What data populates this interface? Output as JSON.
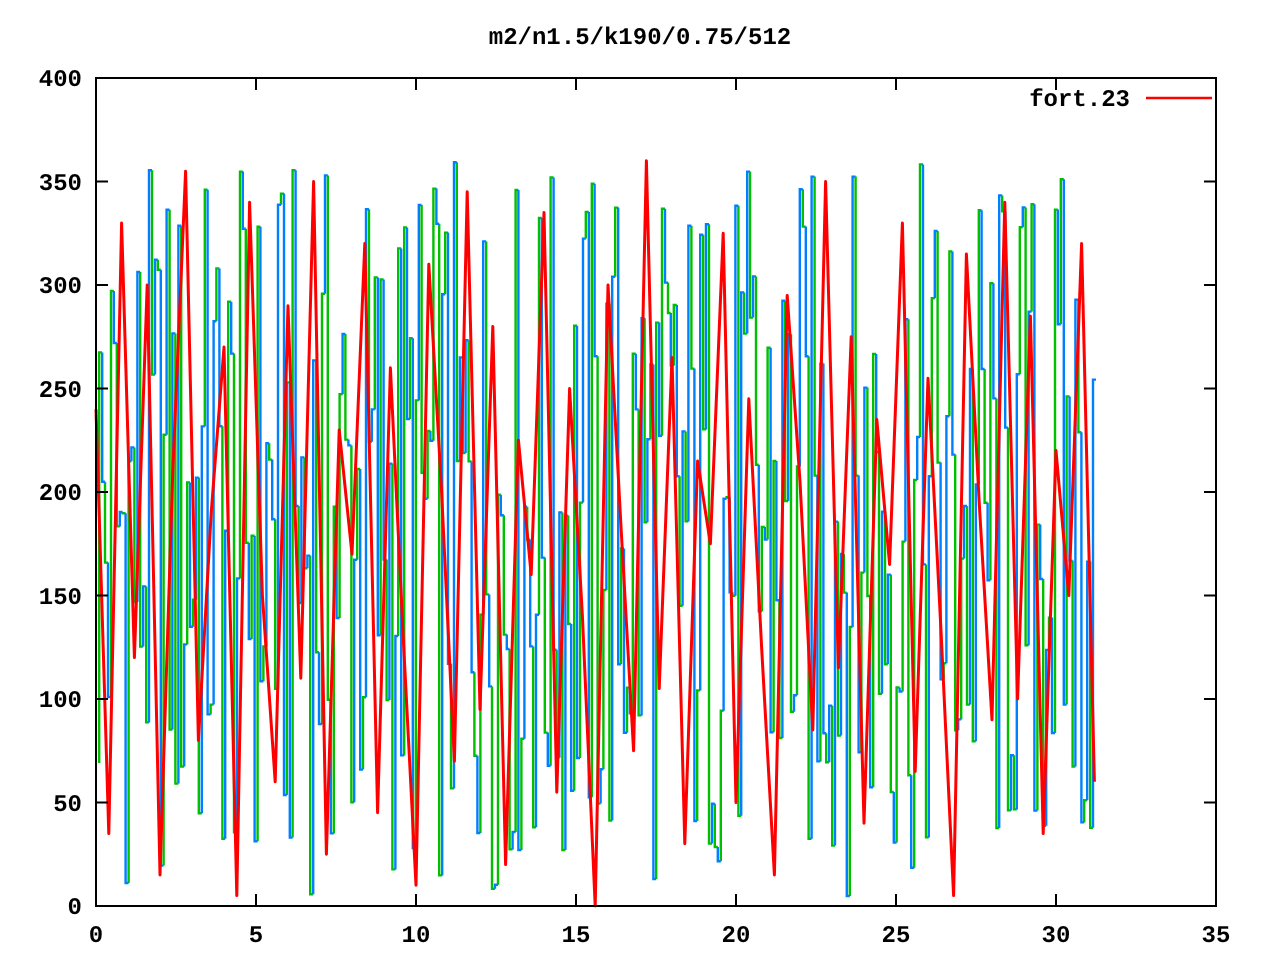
{
  "plot": {
    "chart_data": {
      "type": "line",
      "title": "m2/n1.5/k190/0.75/512",
      "xlim": [
        0,
        35
      ],
      "ylim": [
        0,
        400
      ],
      "xticks": [
        0,
        5,
        10,
        15,
        20,
        25,
        30,
        35
      ],
      "yticks": [
        0,
        50,
        100,
        150,
        200,
        250,
        300,
        350,
        400
      ],
      "x": [
        0,
        0.4,
        0.8,
        1.2,
        1.6,
        2,
        2.4,
        2.8,
        3.2,
        3.6,
        4,
        4.4,
        4.8,
        5.2,
        5.6,
        6,
        6.4,
        6.8,
        7.2,
        7.6,
        8,
        8.4,
        8.8,
        9.2,
        9.6,
        10,
        10.4,
        10.8,
        11.2,
        11.6,
        12,
        12.4,
        12.8,
        13.2,
        13.6,
        14,
        14.4,
        14.8,
        15.2,
        15.6,
        16,
        16.4,
        16.8,
        17.2,
        17.6,
        18,
        18.4,
        18.8,
        19.2,
        19.6,
        20,
        20.4,
        20.8,
        21.2,
        21.6,
        22,
        22.4,
        22.8,
        23.2,
        23.6,
        24,
        24.4,
        24.8,
        25.2,
        25.6,
        26,
        26.4,
        26.8,
        27.2,
        27.6,
        28,
        28.4,
        28.8,
        29.2,
        29.6,
        30,
        30.4,
        30.8,
        31.2
      ],
      "series": [
        {
          "name": "fort.23",
          "color": "#ff0000",
          "values": [
            240,
            35,
            330,
            120,
            300,
            15,
            210,
            355,
            80,
            190,
            270,
            5,
            340,
            150,
            60,
            290,
            110,
            350,
            25,
            230,
            170,
            320,
            45,
            260,
            130,
            10,
            310,
            200,
            70,
            345,
            95,
            280,
            20,
            225,
            160,
            335,
            55,
            250,
            140,
            0,
            300,
            185,
            75,
            360,
            105,
            265,
            30,
            215,
            175,
            325,
            50,
            245,
            125,
            15,
            295,
            205,
            85,
            350,
            115,
            275,
            40,
            235,
            165,
            330,
            65,
            255,
            135,
            5,
            315,
            195,
            90,
            340,
            100,
            285,
            35,
            220,
            150,
            320,
            60
          ]
        }
      ]
    }
  }
}
